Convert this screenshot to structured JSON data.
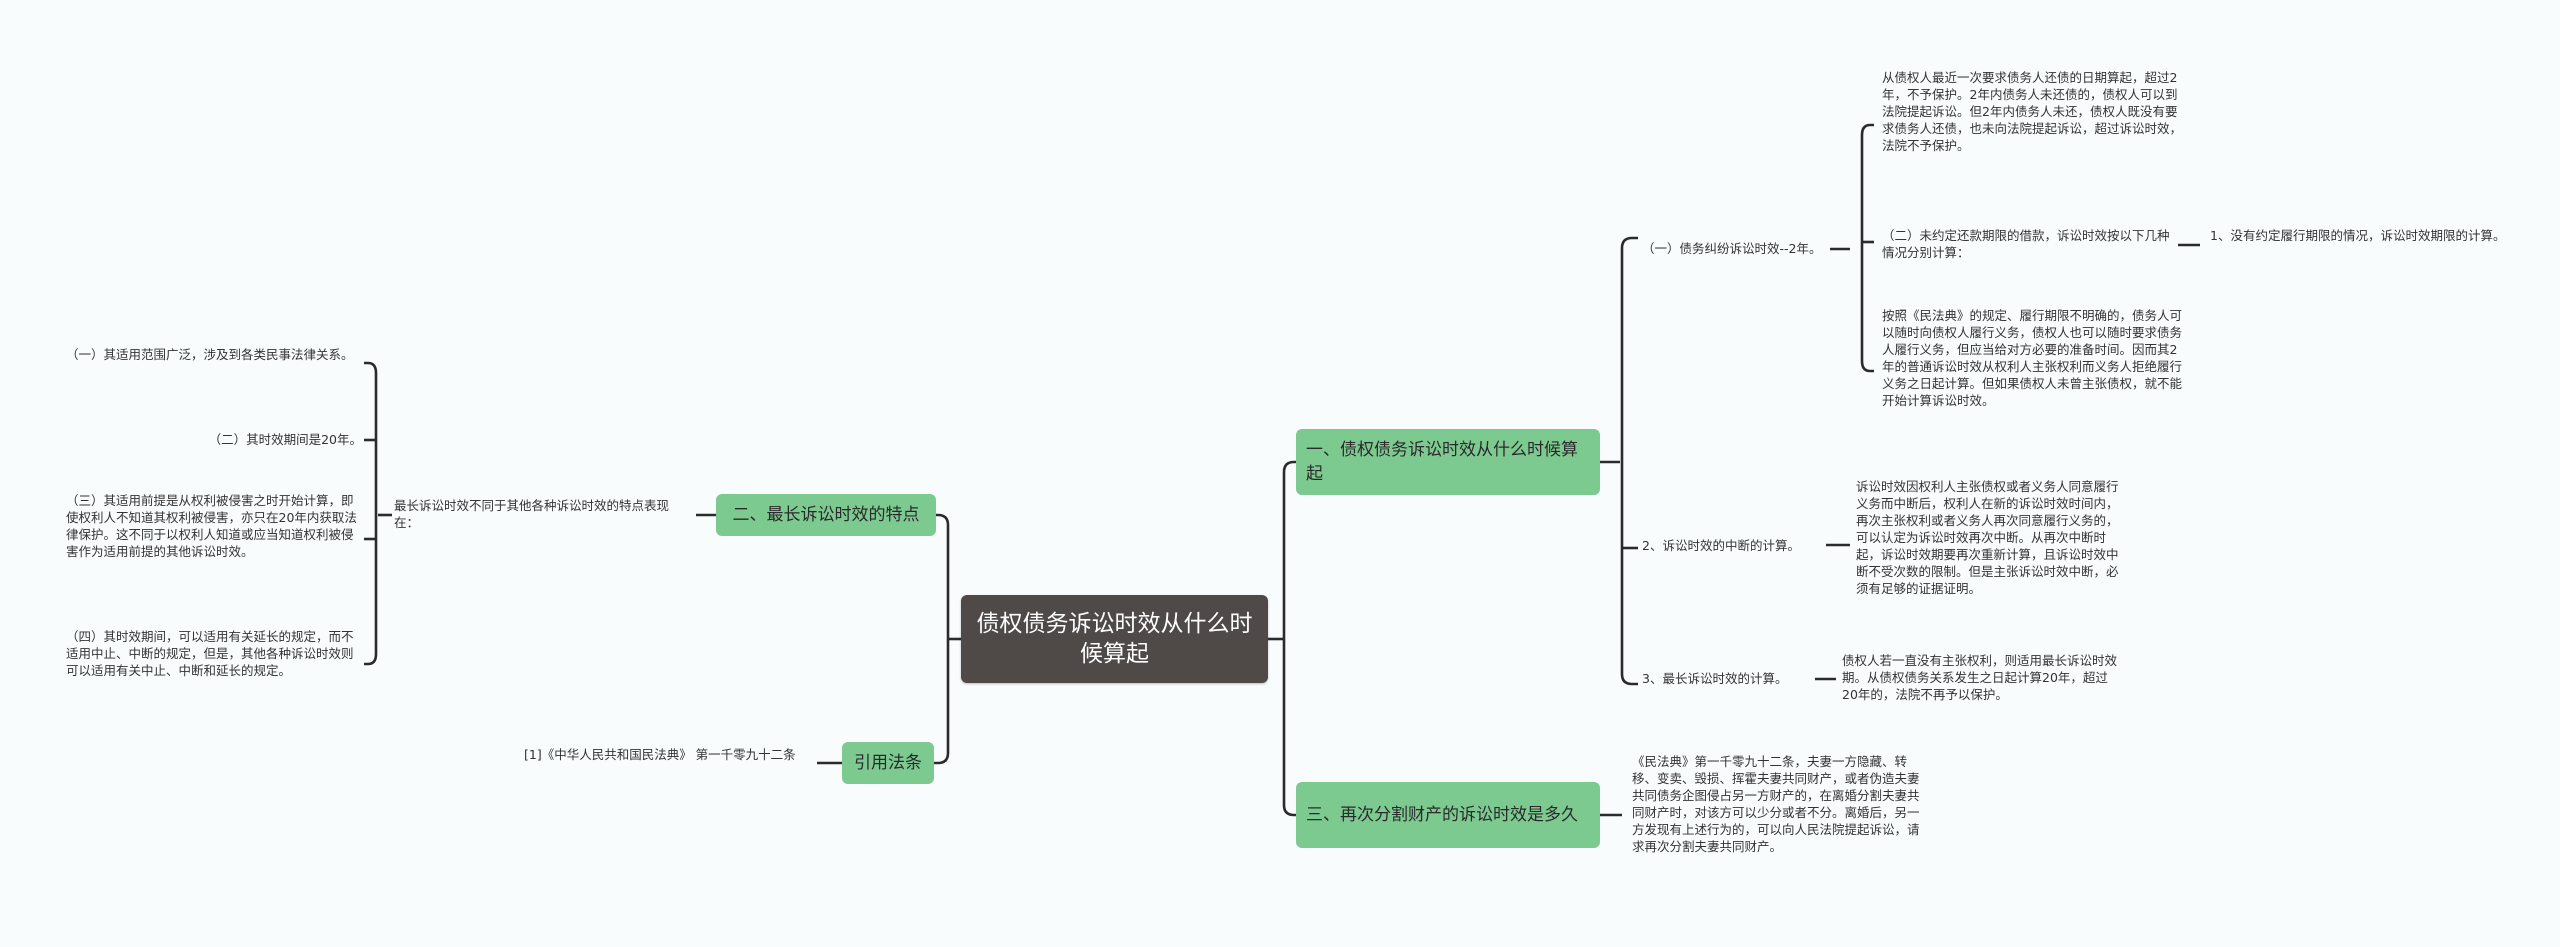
{
  "root": {
    "title": "债权债务诉讼时效从什么时候算起"
  },
  "right_branches": [
    {
      "label": "一、债权债务诉讼时效从什么时候算起",
      "children": [
        {
          "label": "（一）债务纠纷诉讼时效--2年。",
          "children": [
            {
              "text": "从债权人最近一次要求债务人还债的日期算起，超过2年，不予保护。2年内债务人未还债的，债权人可以到法院提起诉讼。但2年内债务人未还，债权人既没有要求债务人还债，也未向法院提起诉讼，超过诉讼时效，法院不予保护。"
            },
            {
              "text": "（二）未约定还款期限的借款，诉讼时效按以下几种情况分别计算：",
              "child": "1、没有约定履行期限的情况，诉讼时效期限的计算。"
            },
            {
              "text": "按照《民法典》的规定、履行期限不明确的，债务人可以随时向债权人履行义务，债权人也可以随时要求债务人履行义务，但应当给对方必要的准备时间。因而其2年的普通诉讼时效从权利人主张权利而义务人拒绝履行义务之日起计算。但如果债权人未曾主张债权，就不能开始计算诉讼时效。"
            }
          ]
        },
        {
          "label": "2、诉讼时效的中断的计算。",
          "detail": "诉讼时效因权利人主张债权或者义务人同意履行义务而中断后，权利人在新的诉讼时效时间内，再次主张权利或者义务人再次同意履行义务的，可以认定为诉讼时效再次中断。从再次中断时起，诉讼时效期要再次重新计算，且诉讼时效中断不受次数的限制。但是主张诉讼时效中断，必须有足够的证据证明。"
        },
        {
          "label": "3、最长诉讼时效的计算。",
          "detail": "债权人若一直没有主张权利，则适用最长诉讼时效期。从债权债务关系发生之日起计算20年，超过20年的，法院不再予以保护。"
        }
      ]
    },
    {
      "label": "三、再次分割财产的诉讼时效是多久",
      "detail": "《民法典》第一千零九十二条，夫妻一方隐藏、转移、变卖、毁损、挥霍夫妻共同财产，或者伪造夫妻共同债务企图侵占另一方财产的，在离婚分割夫妻共同财产时，对该方可以少分或者不分。离婚后，另一方发现有上述行为的，可以向人民法院提起诉讼，请求再次分割夫妻共同财产。"
    }
  ],
  "left_branches": [
    {
      "label": "二、最长诉讼时效的特点",
      "summary": "最长诉讼时效不同于其他各种诉讼时效的特点表现在：",
      "items": [
        "（一）其适用范围广泛，涉及到各类民事法律关系。",
        "（二）其时效期间是20年。",
        "（三）其适用前提是从权利被侵害之时开始计算，即使权利人不知道其权利被侵害，亦只在20年内获取法律保护。这不同于以权利人知道或应当知道权利被侵害作为适用前提的其他诉讼时效。",
        "（四）其时效期间，可以适用有关延长的规定，而不适用中止、中断的规定，但是，其他各种诉讼时效则可以适用有关中止、中断和延长的规定。"
      ]
    },
    {
      "label": "引用法条",
      "items": [
        "[1]《中华人民共和国民法典》 第一千零九十二条"
      ]
    }
  ],
  "colors": {
    "background": "#f8fcfd",
    "root_fill": "#4f4948",
    "branch_fill": "#7dca91",
    "connector": "#2b2b2b",
    "text": "#333333"
  }
}
